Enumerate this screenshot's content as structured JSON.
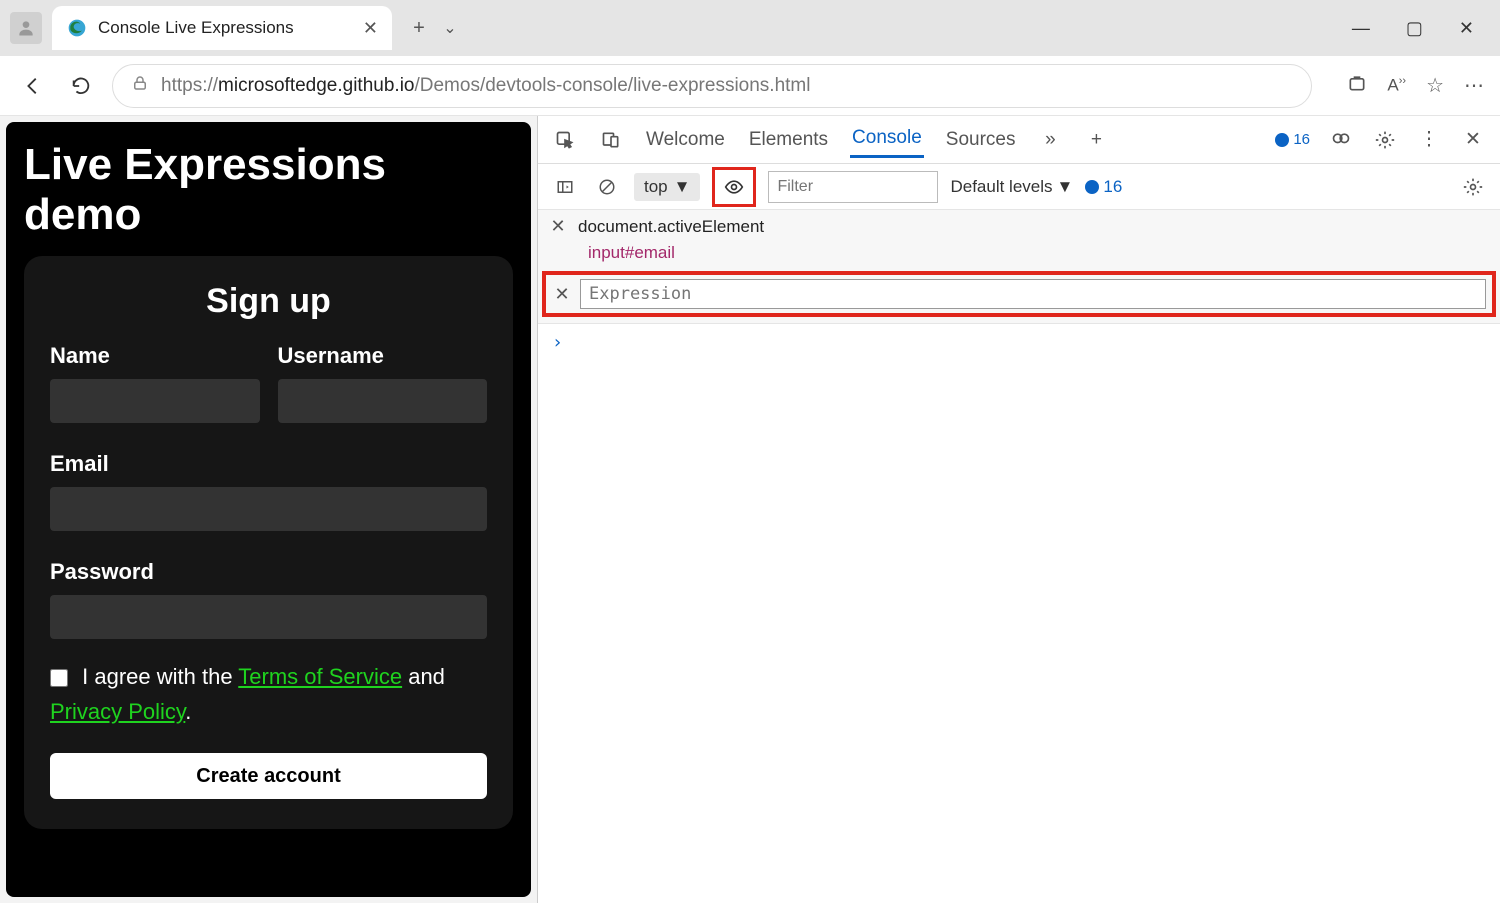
{
  "browser": {
    "tab_title": "Console Live Expressions",
    "url_prefix": "https://",
    "url_host": "microsoftedge.github.io",
    "url_path": "/Demos/devtools-console/live-expressions.html"
  },
  "page": {
    "heading": "Live Expressions demo",
    "card_title": "Sign up",
    "labels": {
      "name": "Name",
      "username": "Username",
      "email": "Email",
      "password": "Password"
    },
    "agree_pre": "I agree with the ",
    "tos": "Terms of Service",
    "agree_mid": " and ",
    "privacy": "Privacy Policy",
    "agree_post": ".",
    "create_btn": "Create account"
  },
  "devtools": {
    "tabs": {
      "welcome": "Welcome",
      "elements": "Elements",
      "console": "Console",
      "sources": "Sources"
    },
    "issue_count": "16",
    "toolbar": {
      "context": "top",
      "filter_placeholder": "Filter",
      "levels": "Default levels",
      "issues": "16"
    },
    "live_expression_1": {
      "expr": "document.activeElement",
      "result": "input#email"
    },
    "live_expression_2": {
      "placeholder": "Expression"
    },
    "prompt": "›"
  }
}
